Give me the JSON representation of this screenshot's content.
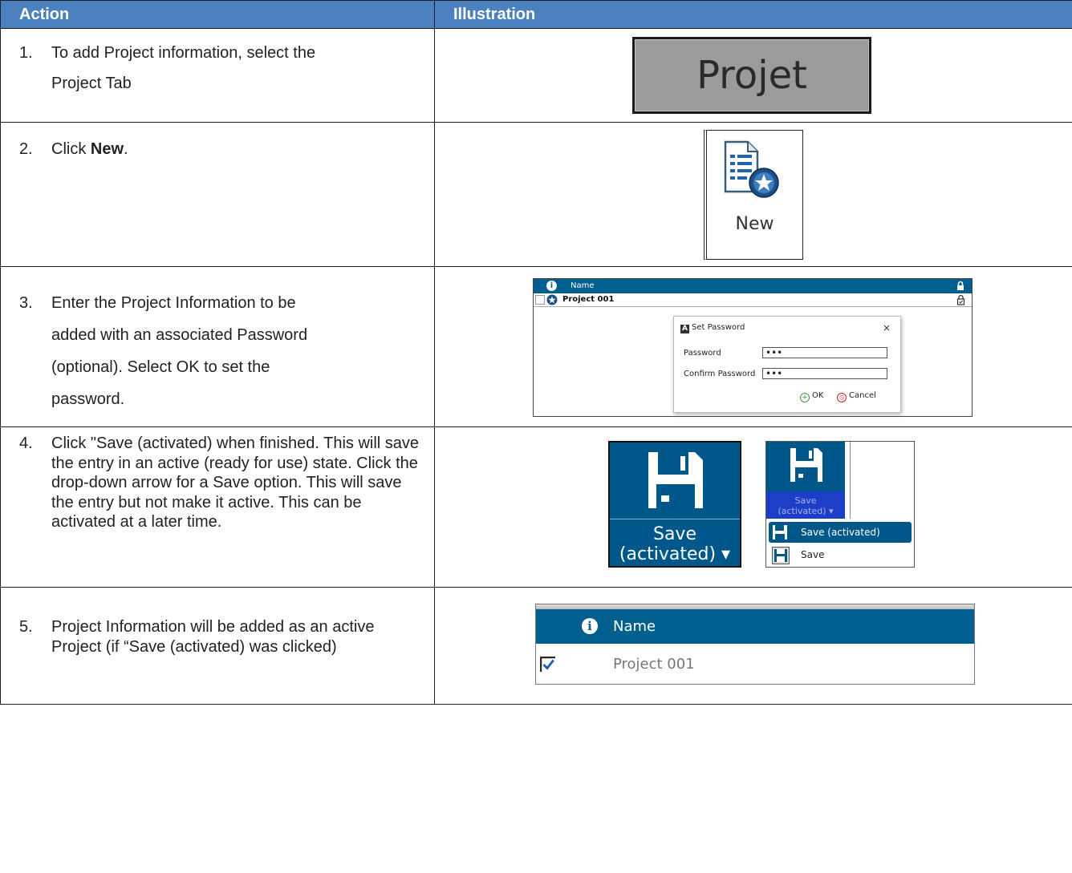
{
  "headers": {
    "action": "Action",
    "illustration": "Illustration"
  },
  "steps": [
    {
      "num": "1.",
      "lines": [
        "To add Project information, select the",
        "Project Tab"
      ]
    },
    {
      "num": "2.",
      "pre": "Click ",
      "bold": "New",
      "post": "."
    },
    {
      "num": "3.",
      "lines": [
        "Enter the Project Information to be",
        "added with an associated Password",
        "(optional). Select OK to set the",
        "password."
      ]
    },
    {
      "num": "4.",
      "text": "Click \"Save (activated) when finished. This will save the entry in an active (ready for use) state. Click the drop-down arrow for a Save option. This will save the entry but not make it active. This can be activated at a later time."
    },
    {
      "num": "5.",
      "text": "Project Information will be added as an active Project (if “Save (activated) was clicked)"
    }
  ],
  "illus1": {
    "tab_label": "Projet"
  },
  "illus2": {
    "button_label": "New"
  },
  "illus3": {
    "col_name": "Name",
    "project_name": "Project 001",
    "dialog_title": "Set Password",
    "close": "×",
    "password_label": "Password",
    "confirm_label": "Confirm Password",
    "password_value": "•••",
    "confirm_value": "•••",
    "ok": "OK",
    "cancel": "Cancel"
  },
  "illus4": {
    "big_line1": "Save",
    "big_line2": "(activated) ▾",
    "small_line1": "Save",
    "small_line2": "(activated) ▾",
    "menu": [
      "Save (activated)",
      "Save"
    ]
  },
  "illus5": {
    "col_name": "Name",
    "project_name": "Project 001",
    "checked": true
  },
  "colors": {
    "header_bg": "#4a81be",
    "app_blue": "#005f8f"
  },
  "icons": [
    "new-document-icon",
    "star-badge-icon",
    "info-icon",
    "lock-icon",
    "save-disk-icon",
    "checkbox-icon",
    "plus-circle-icon",
    "cancel-circle-icon"
  ]
}
